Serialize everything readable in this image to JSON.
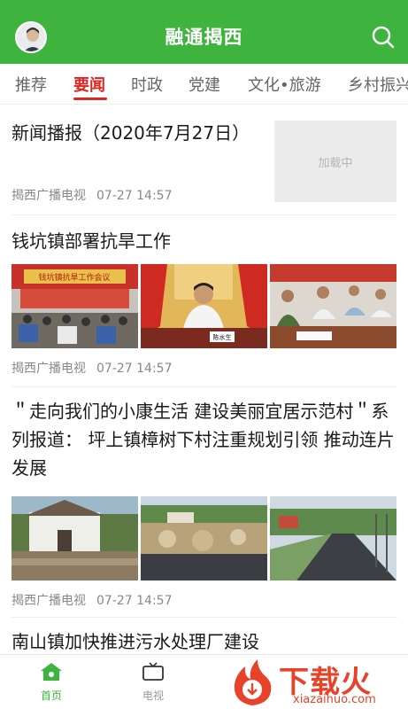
{
  "header": {
    "title": "融通揭西"
  },
  "tabs": [
    "推荐",
    "要闻",
    "时政",
    "党建",
    "文化•旅游",
    "乡村振兴"
  ],
  "articles": [
    {
      "title": "新闻播报（2020年7月27日）",
      "source": "揭西广播电视",
      "time": "07-27 14:57",
      "image_placeholder": "加载中"
    },
    {
      "title": "钱坑镇部署抗旱工作",
      "source": "揭西广播电视",
      "time": "07-27 14:57"
    },
    {
      "title": "＂走向我们的小康生活  建设美丽宜居示范村＂系列报道：  坪上镇樟树下村注重规划引领  推动连片发展",
      "source": "揭西广播电视",
      "time": "07-27 14:57"
    },
    {
      "title": "南山镇加快推进污水处理厂建设"
    }
  ],
  "photo_captions": {
    "banner": "钱坑镇抗旱工作会议",
    "nameplate": "陈水生"
  },
  "bottom_nav": [
    {
      "label": "首页",
      "color": "#3eb33e"
    },
    {
      "label": "电视",
      "color": "#999999"
    }
  ],
  "watermark": {
    "text": "下载火",
    "url": "xiazaihuo.com"
  },
  "colors": {
    "brand_green": "#3eb33e",
    "active_red": "#e0241e"
  },
  "icons": [
    "avatar-icon",
    "search-icon",
    "home-icon",
    "tv-icon",
    "flame-logo"
  ]
}
